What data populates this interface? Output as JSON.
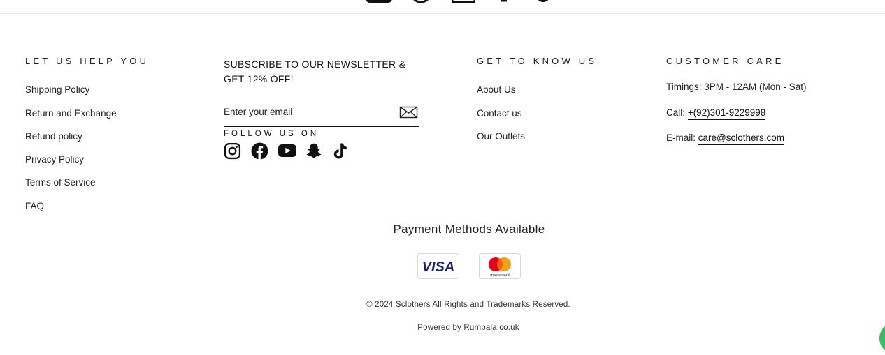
{
  "footer": {
    "help": {
      "title": "LET US HELP YOU",
      "links": [
        "Shipping Policy",
        "Return and Exchange",
        "Refund policy",
        "Privacy Policy",
        "Terms of Service",
        "FAQ"
      ]
    },
    "newsletter": {
      "title": "SUBSCRIBE TO OUR NEWSLETTER & GET 12% OFF!",
      "email_placeholder": "Enter your email",
      "follow_label": "FOLLOW US ON",
      "social_icons": [
        "instagram-icon",
        "facebook-icon",
        "youtube-icon",
        "snapchat-icon",
        "tiktok-icon"
      ]
    },
    "about": {
      "title": "GET TO KNOW US",
      "links": [
        "About Us",
        "Contact us",
        "Our Outlets"
      ]
    },
    "care": {
      "title": "CUSTOMER CARE",
      "timings": "Timings: 3PM - 12AM (Mon - Sat)",
      "call_label": "Call:",
      "phone": "+(92)301-9229998",
      "email_label": "E-mail:",
      "email": "care@sclothers.com"
    },
    "payment": {
      "title": "Payment Methods Available",
      "methods": [
        "VISA",
        "mastercard"
      ]
    },
    "copyright": "© 2024 Sclothers All Rights and Trademarks Reserved.",
    "powered_by": "Powered by Rumpala.co.uk"
  },
  "colors": {
    "text": "#222222",
    "visa_blue": "#1a1f71",
    "mc_red": "#eb001b",
    "mc_orange": "#f79e1b",
    "chat_green": "#35c063"
  }
}
